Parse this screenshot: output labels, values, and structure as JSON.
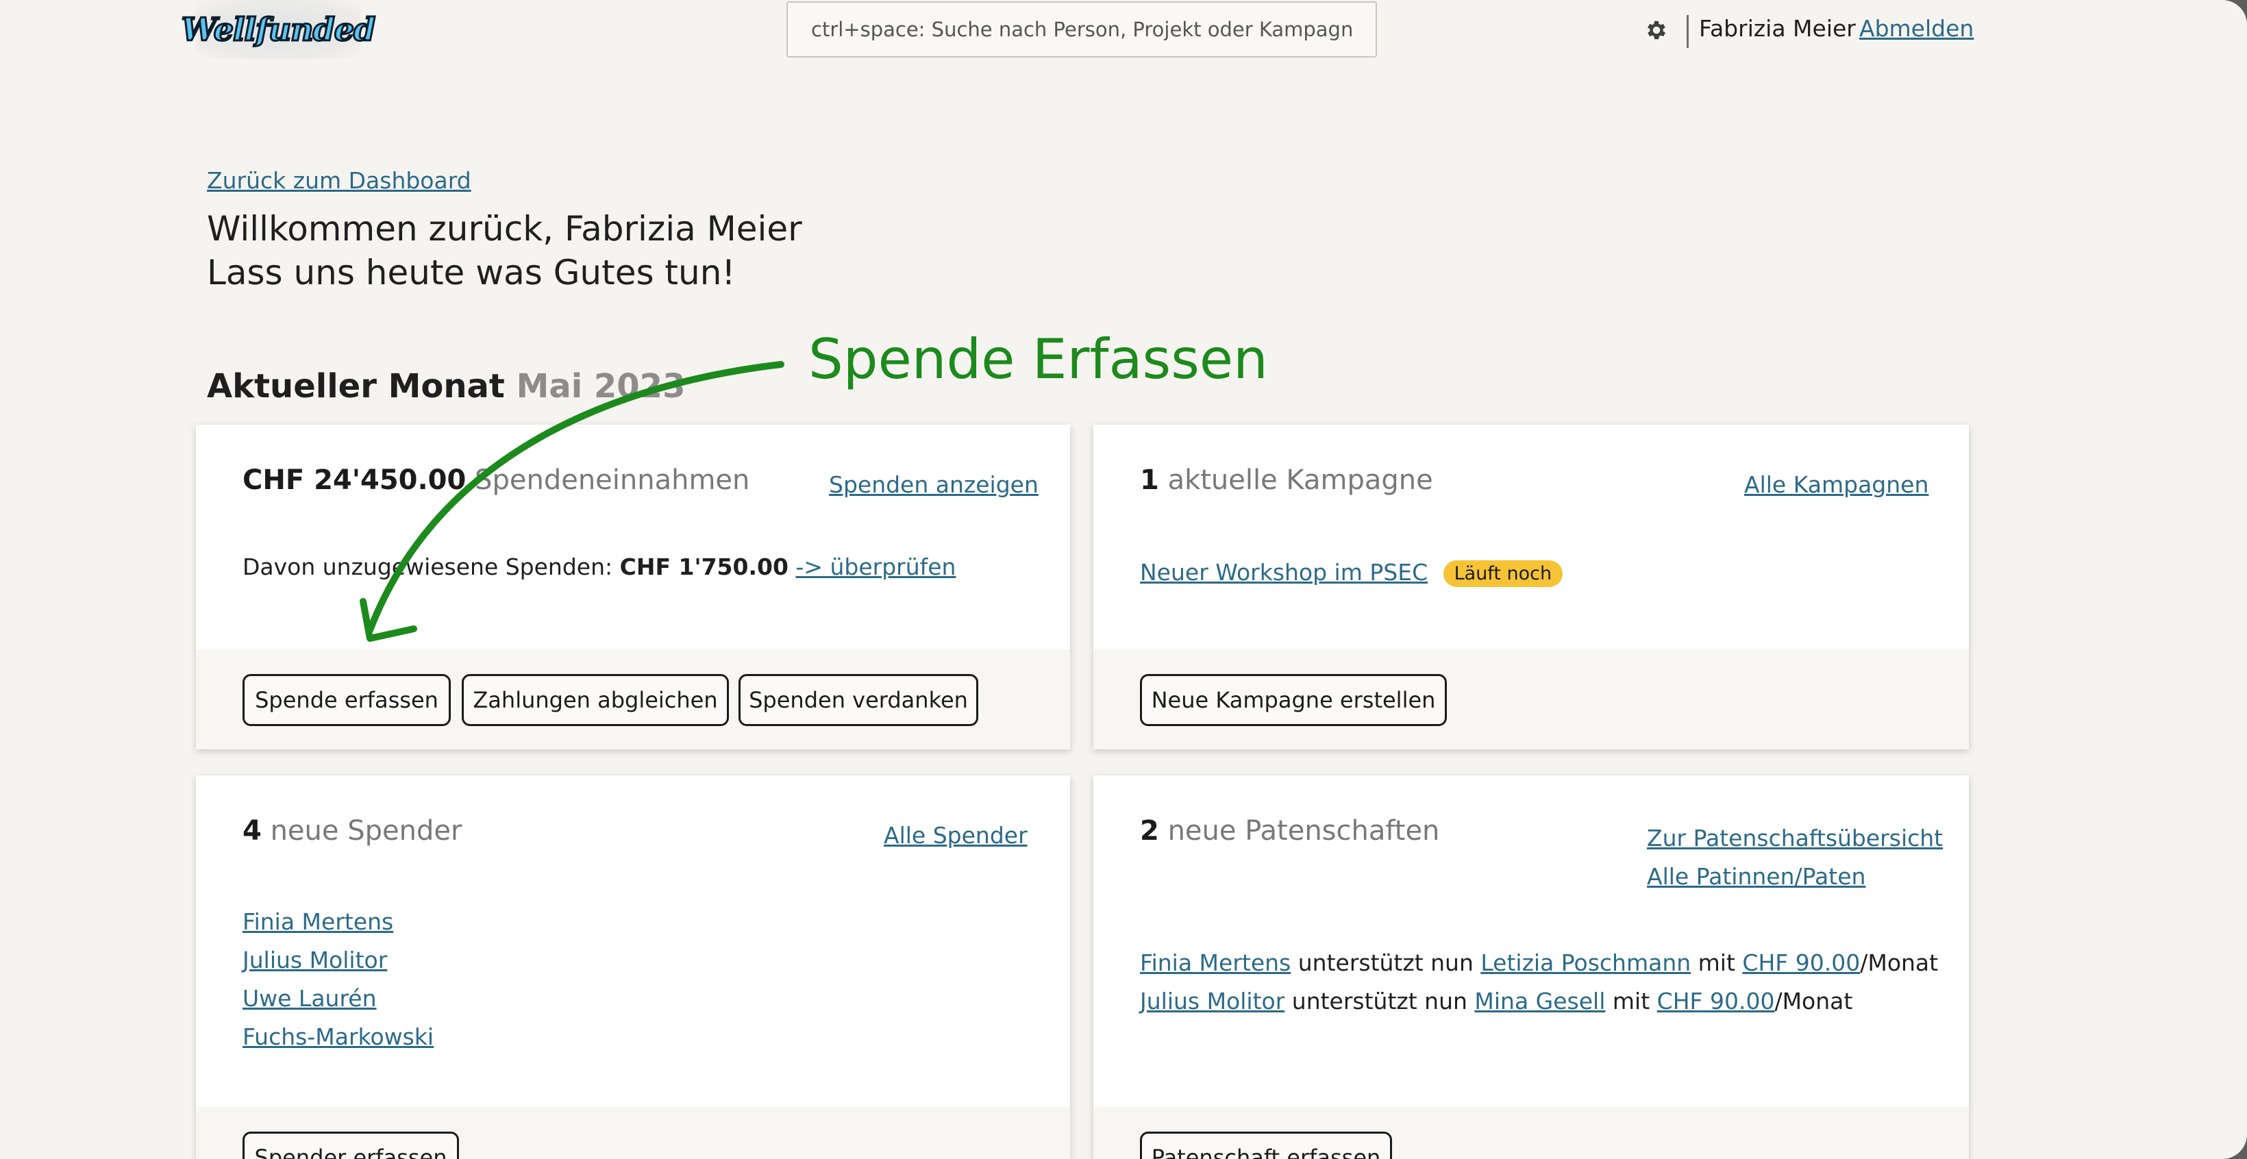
{
  "header": {
    "logo_text": "Wellfunded",
    "search_placeholder": "ctrl+space: Suche nach Person, Projekt oder Kampagne",
    "settings_icon": "gear-icon",
    "user_name": "Fabrizia Meier",
    "logout_label": "Abmelden"
  },
  "nav": {
    "back_label": "Zurück zum Dashboard"
  },
  "welcome": {
    "line1": "Willkommen zurück, Fabrizia Meier",
    "line2": "Lass uns heute was Gutes tun!"
  },
  "section": {
    "title": "Aktueller Monat",
    "month": "Mai 2023"
  },
  "annotation": {
    "text": "Spende Erfassen",
    "color": "#1c8a1c"
  },
  "donations_card": {
    "amount": "CHF 24'450.00",
    "label": "Spendeneinnahmen",
    "link": "Spenden anzeigen",
    "unassigned_prefix": "Davon unzugewiesene Spenden:",
    "unassigned_amount": "CHF 1'750.00",
    "unassigned_link": "-> überprüfen",
    "buttons": [
      "Spende erfassen",
      "Zahlungen abgleichen",
      "Spenden verdanken"
    ]
  },
  "campaign_card": {
    "count": "1",
    "label": "aktuelle Kampagne",
    "link": "Alle Kampagnen",
    "campaign_name": "Neuer Workshop im PSEC",
    "campaign_status": "Läuft noch",
    "status_color": "#f6c335",
    "button": "Neue Kampagne erstellen"
  },
  "donors_card": {
    "count": "4",
    "label": "neue Spender",
    "link": "Alle Spender",
    "donors": [
      "Finia Mertens",
      "Julius Molitor",
      "Uwe Laurén",
      "Fuchs-Markowski"
    ],
    "button": "Spender erfassen"
  },
  "sponsorship_card": {
    "count": "2",
    "label": "neue Patenschaften",
    "link1": "Zur Patenschaftsübersicht",
    "link2": "Alle Patinnen/Paten",
    "rows": [
      {
        "sponsor": "Finia Mertens",
        "verb": "unterstützt nun",
        "child": "Letizia Poschmann",
        "with": "mit",
        "amount": "CHF 90.00",
        "period": "/Monat"
      },
      {
        "sponsor": "Julius Molitor",
        "verb": "unterstützt nun",
        "child": "Mina Gesell",
        "with": "mit",
        "amount": "CHF 90.00",
        "period": "/Monat"
      }
    ],
    "button": "Patenschaft erfassen"
  }
}
